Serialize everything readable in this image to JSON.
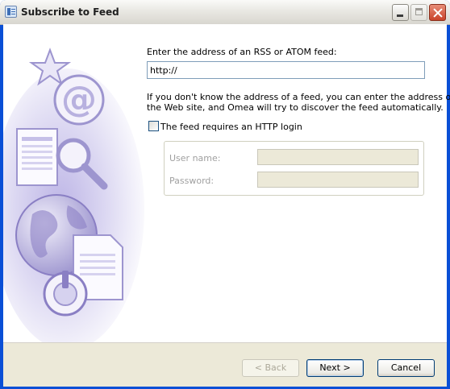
{
  "window": {
    "title": "Subscribe to Feed"
  },
  "form": {
    "prompt": "Enter the address of an RSS or ATOM feed:",
    "url_value": "http://",
    "hint_line1": "If you don't know the address of a feed, you can enter the address of",
    "hint_line2": "the Web site, and Omea will try to discover the feed automatically.",
    "login_checkbox_label": "The feed requires an HTTP login",
    "login_checked": false,
    "username_label": "User name:",
    "password_label": "Password:",
    "username_value": "",
    "password_value": ""
  },
  "buttons": {
    "back": "< Back",
    "next": "Next >",
    "cancel": "Cancel"
  },
  "colors": {
    "accent": "#0a4fd6",
    "art_tint": "#8a7fc4"
  }
}
